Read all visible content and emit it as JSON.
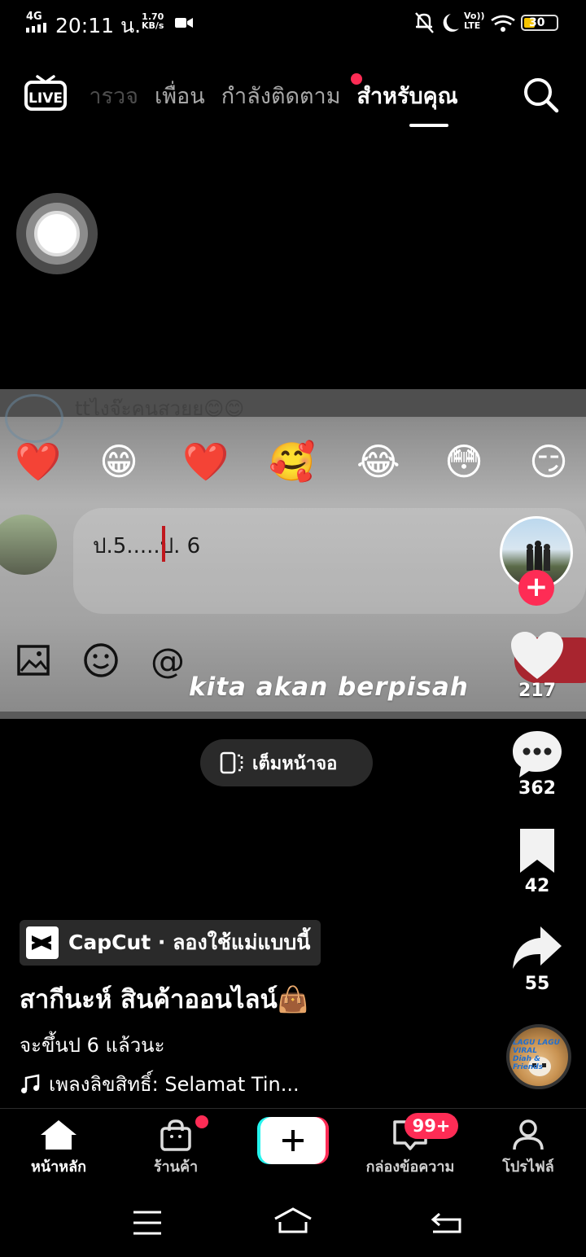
{
  "status_bar": {
    "network": "4G",
    "time": "20:11 น.",
    "speed_value": "1.70",
    "speed_unit": "KB/s",
    "volte_line1": "Vo))",
    "volte_line2": "LTE",
    "battery": "30"
  },
  "top_nav": {
    "live_label": "LIVE",
    "tabs": [
      {
        "label": "สำรวจ"
      },
      {
        "label": "เพื่อน"
      },
      {
        "label": "กำลังติดตาม"
      },
      {
        "label": "สำหรับคุณ"
      }
    ],
    "active_tab": "สำหรับคุณ"
  },
  "video": {
    "top_text": "ttไงจ๊ะคนสวยย😊😊",
    "emojis": [
      "❤️",
      "😁",
      "❤️",
      "🥰",
      "😂",
      "😳",
      "😏"
    ],
    "input_text": "ป.5.....ป. 6",
    "caption": "kita akan berpisah"
  },
  "fullscreen_button": {
    "label": "เต็มหน้าจอ"
  },
  "actions": {
    "likes": "217",
    "comments": "362",
    "saves": "42",
    "shares": "55"
  },
  "music_disc": {
    "label_line1": "LAGU LAGU VIRAL",
    "label_line2": "Diah & Friends"
  },
  "info": {
    "capcut_label": "CapCut · ลองใช้แม่แบบนี้",
    "author": "สากีนะห์ สินค้าออนไลน์👜",
    "description": "จะขึ้นป 6 แล้วนะ",
    "music": "เพลงลิขสิทธิ์: Selamat Tin..."
  },
  "bottom_nav": {
    "home": "หน้าหลัก",
    "shop": "ร้านค้า",
    "inbox": "กล่องข้อความ",
    "inbox_badge": "99+",
    "profile": "โปรไฟล์"
  },
  "colors": {
    "accent": "#fe2c55",
    "background": "#000000",
    "battery": "#f5c400"
  }
}
